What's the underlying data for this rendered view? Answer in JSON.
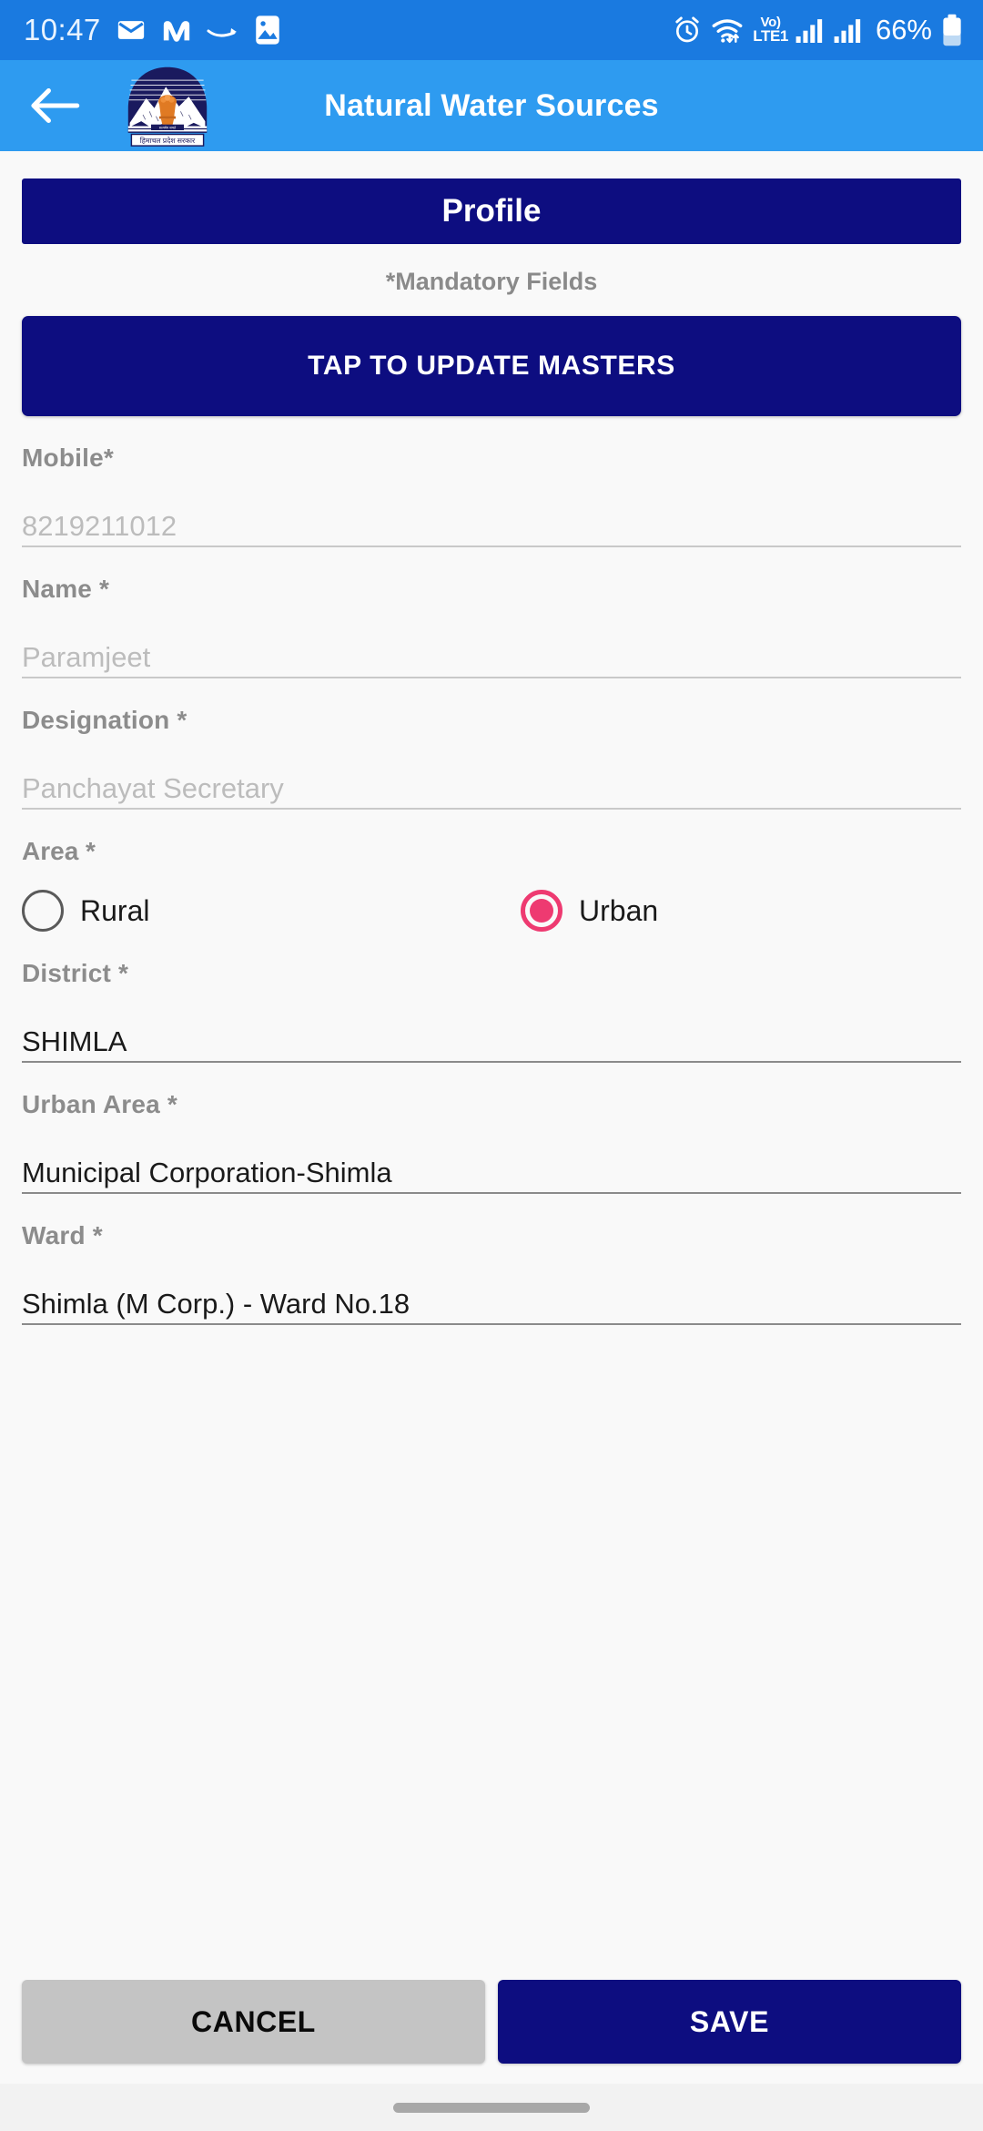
{
  "status_bar": {
    "time": "10:47",
    "battery_percent": "66%",
    "volte_top": "Vo)",
    "volte_bottom": "LTE1",
    "left_icons": [
      "mail-icon",
      "monzo-m-icon",
      "amazon-icon",
      "gallery-icon"
    ],
    "right_icons": [
      "alarm-icon",
      "wifi-icon",
      "volte-label",
      "signal-bars-sim1-icon",
      "signal-bars-sim2-icon",
      "battery-icon"
    ],
    "background_color": "#1a7ae0"
  },
  "app_bar": {
    "back_icon": "back-arrow-icon",
    "logo_icon": "himachal-pradesh-government-emblem",
    "logo_caption": "हिमाचल प्रदेश सरकार",
    "title": "Natural Water Sources",
    "background_color": "#2e9bf0"
  },
  "main": {
    "section_title": "Profile",
    "mandatory_note": "*Mandatory Fields",
    "update_masters_label": "TAP TO UPDATE MASTERS",
    "accent_navy": "#0d0d80",
    "accent_pink": "#ee3a71",
    "fields": [
      {
        "label": "Mobile*",
        "value": "8219211012",
        "filled": false
      },
      {
        "label": "Name *",
        "value": "Paramjeet",
        "filled": false
      },
      {
        "label": "Designation *",
        "value": "Panchayat Secretary",
        "filled": false
      },
      {
        "label": "District *",
        "value": "SHIMLA",
        "filled": true
      },
      {
        "label": "Urban Area *",
        "value": "Municipal Corporation-Shimla",
        "filled": true
      },
      {
        "label": "Ward *",
        "value": "Shimla (M Corp.) - Ward No.18",
        "filled": true
      }
    ],
    "area": {
      "label": "Area *",
      "options": [
        {
          "label": "Rural",
          "selected": false
        },
        {
          "label": "Urban",
          "selected": true
        }
      ]
    }
  },
  "footer": {
    "cancel_label": "CANCEL",
    "save_label": "SAVE"
  }
}
